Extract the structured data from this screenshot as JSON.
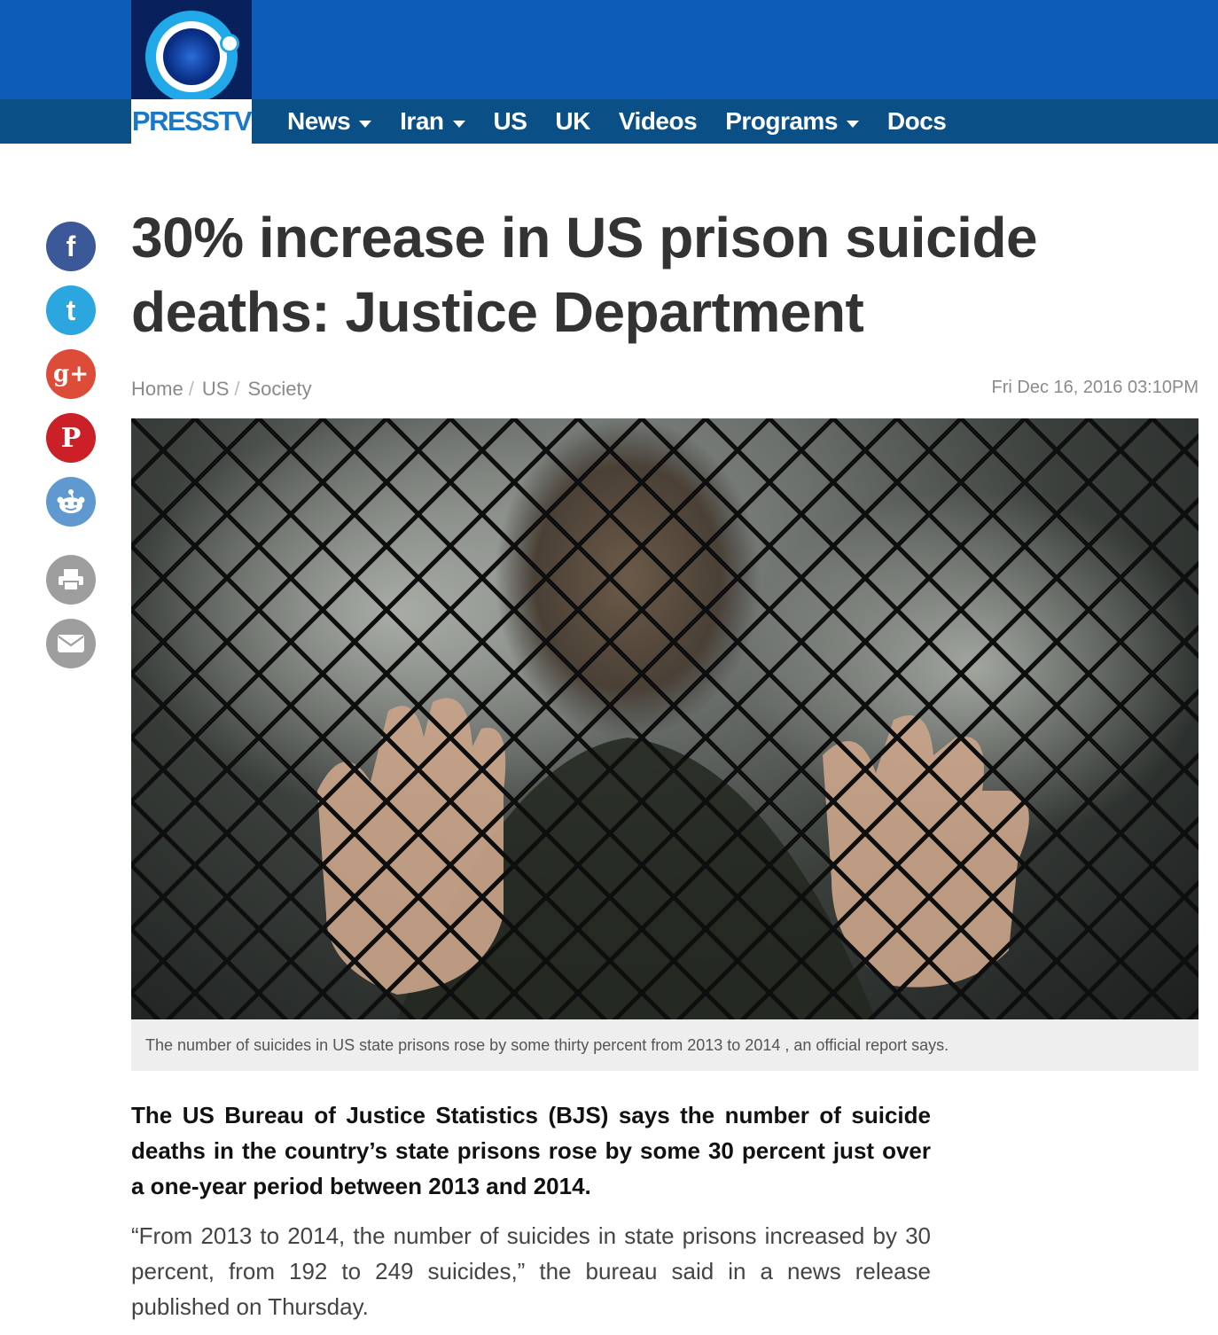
{
  "brand": {
    "name": "PRESSTV"
  },
  "nav": {
    "items": [
      {
        "label": "News",
        "has_dropdown": true
      },
      {
        "label": "Iran",
        "has_dropdown": true
      },
      {
        "label": "US",
        "has_dropdown": false
      },
      {
        "label": "UK",
        "has_dropdown": false
      },
      {
        "label": "Videos",
        "has_dropdown": false
      },
      {
        "label": "Programs",
        "has_dropdown": true
      },
      {
        "label": "Docs",
        "has_dropdown": false
      }
    ]
  },
  "share": {
    "buttons": [
      {
        "icon": "facebook-icon",
        "glyph": "f",
        "color": "#3b5998"
      },
      {
        "icon": "twitter-icon",
        "glyph": "t",
        "color": "#2ba6de"
      },
      {
        "icon": "google-plus-icon",
        "glyph": "g+",
        "color": "#dd4b39"
      },
      {
        "icon": "pinterest-icon",
        "glyph": "P",
        "color": "#cb2027"
      },
      {
        "icon": "reddit-icon",
        "glyph": "",
        "color": "#5f99cf"
      },
      {
        "icon": "print-icon",
        "glyph": "",
        "color": "#9e9e9e"
      },
      {
        "icon": "email-icon",
        "glyph": "",
        "color": "#9e9e9e"
      }
    ]
  },
  "article": {
    "title": "30% increase in US prison suicide deaths: Justice Department",
    "breadcrumb": [
      "Home",
      "US",
      "Society"
    ],
    "date": "Fri Dec 16, 2016 03:10PM",
    "image_caption": "The number of suicides in US state prisons rose by some thirty percent from 2013 to 2014 , an official report says.",
    "lead": "The US Bureau of Justice Statistics (BJS) says the number of suicide deaths in the country’s state prisons rose by some 30 percent just over a one-year period between 2013 and 2014.",
    "paragraph_1": "“From 2013 to 2014, the number of suicides in state prisons increased by 30 percent, from 192 to 249 suicides,” the bureau said in a news release published on Thursday."
  },
  "colors": {
    "header_blue": "#0c5db8",
    "nav_blue": "#0a4f86",
    "logo_navy": "#08205c",
    "title_text": "#333333"
  }
}
